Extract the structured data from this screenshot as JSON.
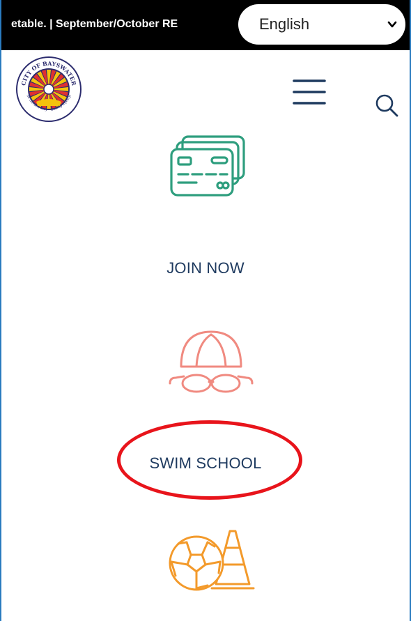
{
  "topbar": {
    "ticker_text": "etable. | September/October RE",
    "language": {
      "selected": "English"
    }
  },
  "header": {
    "logo": {
      "ring_text_top": "CITY OF BAYSWATER",
      "ring_text_bottom": "The Garden City · Quality Lifestyle"
    },
    "menu_icon": "hamburger-menu-icon",
    "search_icon": "search-icon"
  },
  "tiles": [
    {
      "label": "JOIN NOW",
      "icon": "credit-card-icon",
      "color": "#2e9e7e"
    },
    {
      "label": "SWIM SCHOOL",
      "icon": "swim-cap-goggles-icon",
      "color": "#f08a80"
    },
    {
      "label": "",
      "icon": "soccer-ball-cone-icon",
      "color": "#f39a2b"
    }
  ],
  "colors": {
    "topbar": "#000000",
    "label_text": "#1e3a5f",
    "annotation": "#e8141b",
    "frame_border": "#2a7bbf"
  }
}
